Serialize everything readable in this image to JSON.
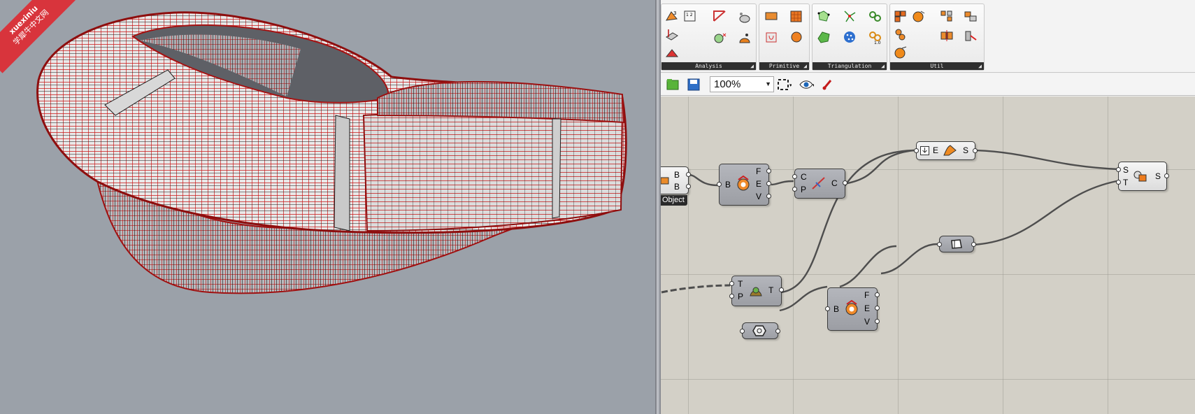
{
  "watermark": {
    "line1": "xuexiniu",
    "line2": "学犀牛中文网"
  },
  "ribbon": {
    "panels": [
      {
        "label": "Analysis"
      },
      {
        "label": "Primitive"
      },
      {
        "label": "Triangulation"
      },
      {
        "label": "Util"
      }
    ]
  },
  "toolbar": {
    "zoom_value": "100%"
  },
  "canvas": {
    "object_tag": "Object",
    "brep_param": {
      "ports_out": [
        "B",
        "B"
      ]
    },
    "deconstruct_brep_1": {
      "ports_in": [
        "B"
      ],
      "ports_out": [
        "F",
        "E",
        "V"
      ]
    },
    "curve_cp": {
      "ports_in": [
        "C",
        "P"
      ],
      "ports_out": [
        "C"
      ]
    },
    "extend_es": {
      "ports_in": [
        "E"
      ],
      "ports_out": [
        "S"
      ]
    },
    "split_st": {
      "ports_in": [
        "S",
        "T"
      ],
      "ports_out": [
        "S"
      ]
    },
    "tp_component": {
      "ports_in": [
        "T",
        "P"
      ],
      "ports_out": [
        "T"
      ]
    },
    "deconstruct_brep_2": {
      "ports_in": [
        "B"
      ],
      "ports_out": [
        "F",
        "E",
        "V"
      ]
    }
  },
  "colors": {
    "wire": "#4d4d4d",
    "component": "#a8aab0",
    "canvas": "#d3d0c7",
    "mesh_red": "#c8161b"
  }
}
